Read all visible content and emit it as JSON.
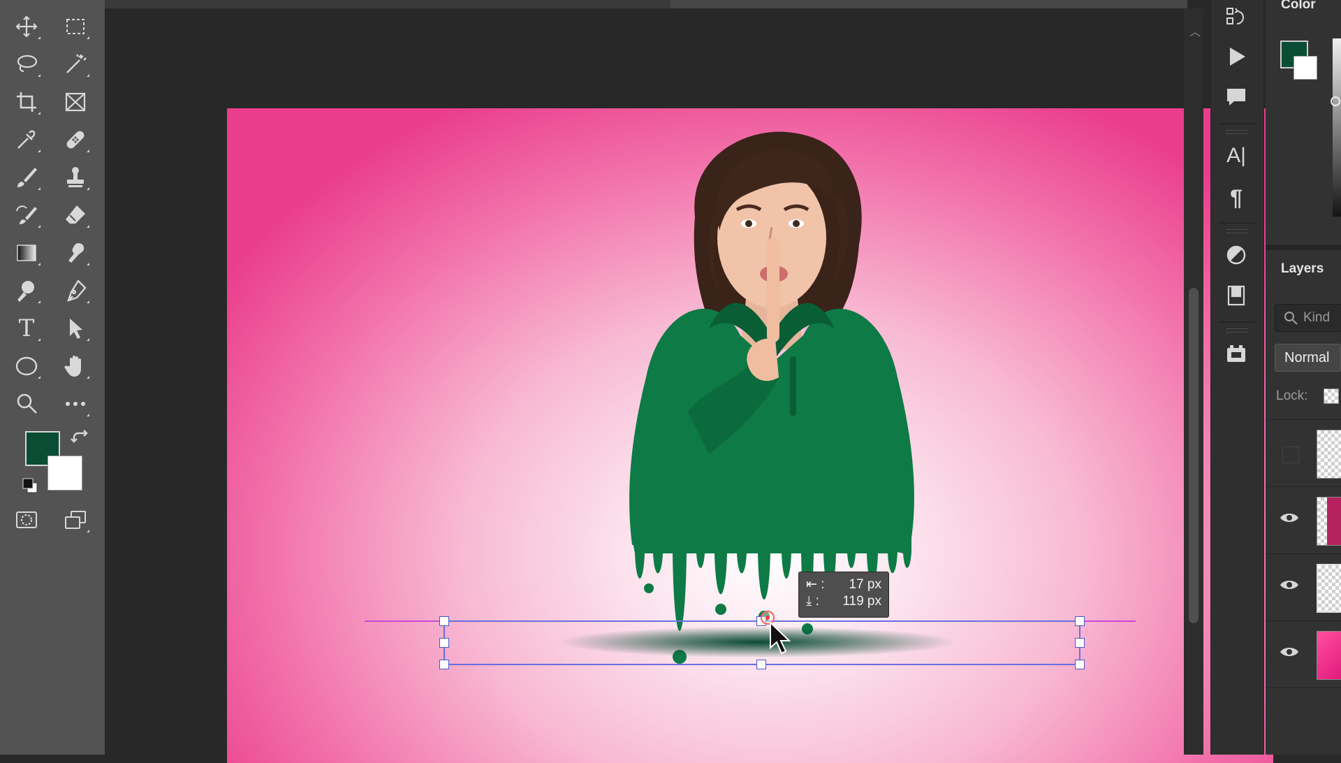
{
  "toolbar": {
    "tools": [
      "move-tool",
      "rectangular-marquee-tool",
      "lasso-tool",
      "magic-wand-tool",
      "crop-tool",
      "frame-tool",
      "eyedropper-tool",
      "spot-healing-tool",
      "brush-tool",
      "clone-stamp-tool",
      "history-brush-tool",
      "eraser-tool",
      "gradient-tool",
      "smudge-tool",
      "dodge-tool",
      "pen-tool",
      "type-tool",
      "path-selection-tool",
      "ellipse-tool",
      "hand-tool",
      "zoom-tool",
      "edit-toolbar"
    ],
    "type_tool_glyph": "T",
    "foreground_color": "#0b4d34",
    "background_color": "#ffffff"
  },
  "document": {
    "background_gradient": [
      "#ffffff",
      "#ea3e8c"
    ],
    "shirt_color": "#0e7a45"
  },
  "tooltip": {
    "horizontal_label": "17 px",
    "vertical_label": "119 px"
  },
  "panels": {
    "color": {
      "title": "Color"
    },
    "layers": {
      "title": "Layers",
      "search_placeholder": "Kind",
      "blend_mode": "Normal",
      "lock_label": "Lock:"
    }
  },
  "right_dock": {
    "character_glyph": "A|",
    "paragraph_glyph": "¶"
  }
}
